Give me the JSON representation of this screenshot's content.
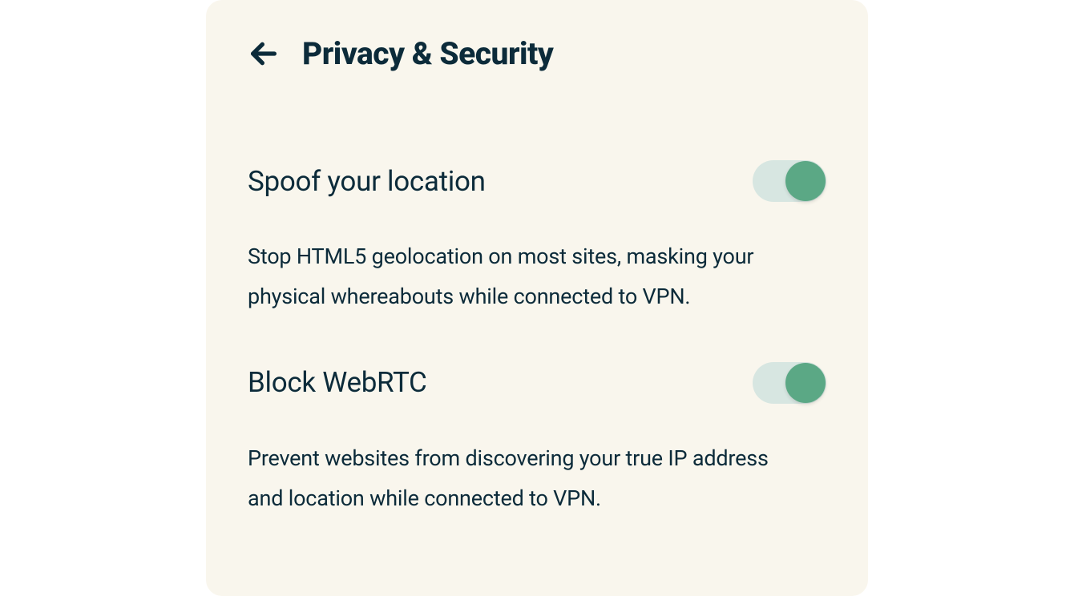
{
  "header": {
    "title": "Privacy & Security"
  },
  "settings": [
    {
      "title": "Spoof your location",
      "description": "Stop HTML5 geolocation on most sites, masking your physical whereabouts while connected to VPN.",
      "enabled": true
    },
    {
      "title": "Block WebRTC",
      "description": "Prevent websites from discovering your true IP address and location while connected to VPN.",
      "enabled": true
    }
  ],
  "colors": {
    "panel_bg": "#f9f6ed",
    "text": "#0c2b3a",
    "toggle_track": "#d7e6e1",
    "toggle_knob": "#5ba885"
  }
}
